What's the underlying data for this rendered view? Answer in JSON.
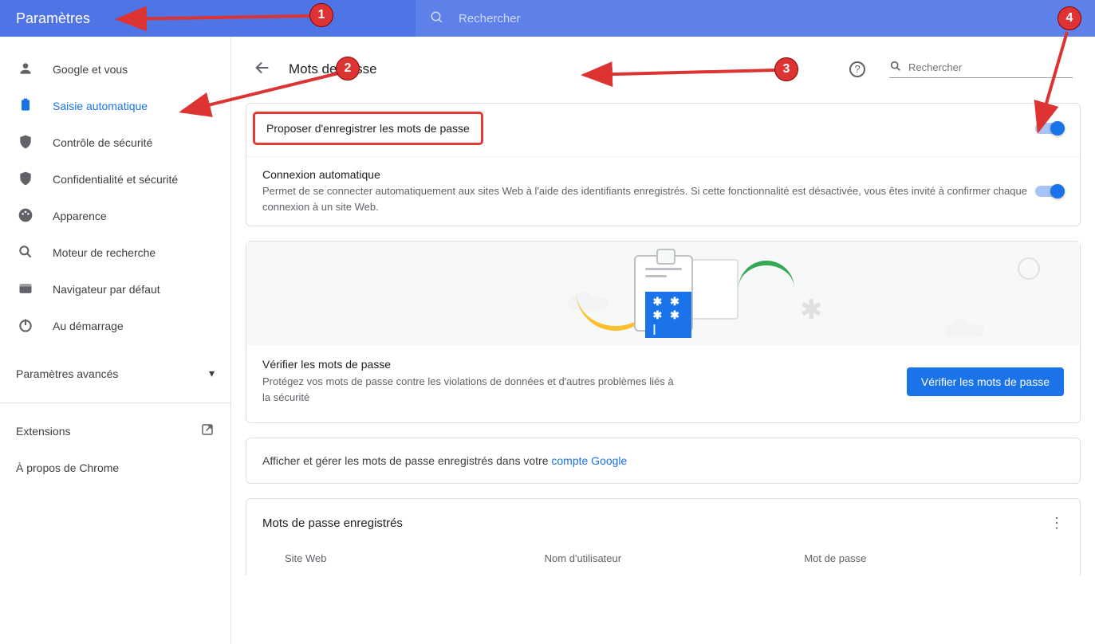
{
  "header": {
    "title": "Paramètres",
    "search_placeholder": "Rechercher"
  },
  "sidebar": {
    "items": [
      {
        "id": "account",
        "label": "Google et vous"
      },
      {
        "id": "autofill",
        "label": "Saisie automatique"
      },
      {
        "id": "safety",
        "label": "Contrôle de sécurité"
      },
      {
        "id": "privacy",
        "label": "Confidentialité et sécurité"
      },
      {
        "id": "appearance",
        "label": "Apparence"
      },
      {
        "id": "search",
        "label": "Moteur de recherche"
      },
      {
        "id": "default",
        "label": "Navigateur par défaut"
      },
      {
        "id": "startup",
        "label": "Au démarrage"
      }
    ],
    "advanced": "Paramètres avancés",
    "extensions": "Extensions",
    "about": "À propos de Chrome",
    "active_id": "autofill"
  },
  "page": {
    "title": "Mots de passe",
    "search_placeholder": "Rechercher"
  },
  "toggles": {
    "offer_save": {
      "label": "Proposer d'enregistrer les mots de passe",
      "on": true
    },
    "auto_signin": {
      "label": "Connexion automatique",
      "desc": "Permet de se connecter automatiquement aux sites Web à l'aide des identifiants enregistrés. Si cette fonctionnalité est désactivée, vous êtes invité à confirmer chaque connexion à un site Web.",
      "on": true
    }
  },
  "check": {
    "title": "Vérifier les mots de passe",
    "desc": "Protégez vos mots de passe contre les violations de données et d'autres problèmes liés à la sécurité",
    "button": "Vérifier les mots de passe"
  },
  "manage": {
    "text_prefix": "Afficher et gérer les mots de passe enregistrés dans votre ",
    "link_text": "compte Google"
  },
  "saved": {
    "title": "Mots de passe enregistrés",
    "columns": {
      "site": "Site Web",
      "user": "Nom d'utilisateur",
      "pass": "Mot de passe"
    }
  },
  "illustration": {
    "badge": "✱ ✱ ✱ ✱ |"
  },
  "annotations": {
    "1": "1",
    "2": "2",
    "3": "3",
    "4": "4"
  }
}
